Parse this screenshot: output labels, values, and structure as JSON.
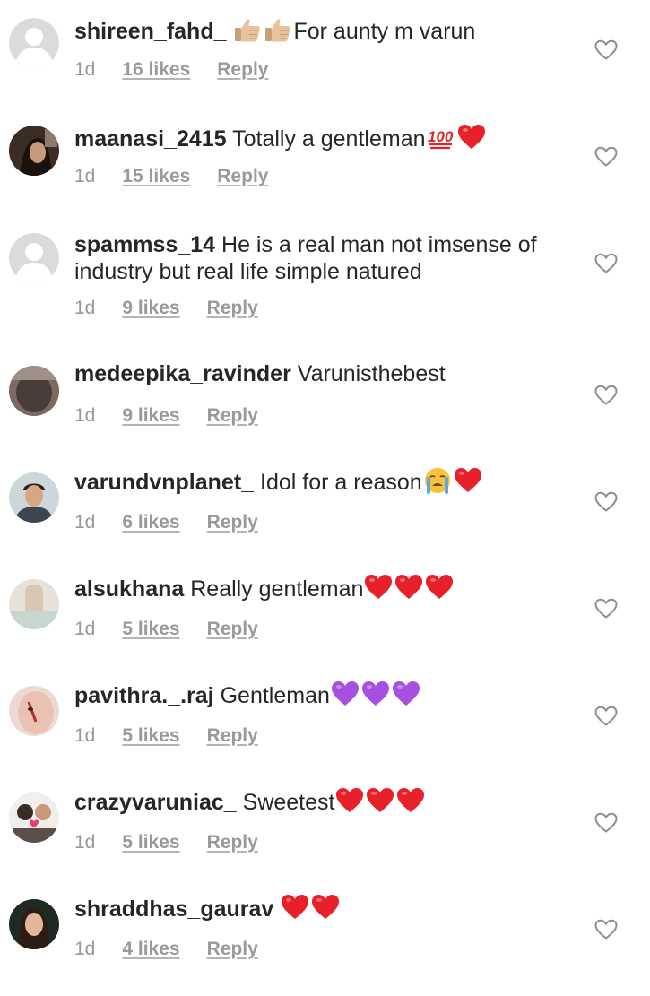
{
  "comments": [
    {
      "username": "shireen_fahd_",
      "text": "For aunty m varun",
      "emojis_before": [
        "thumbs-up",
        "thumbs-up"
      ],
      "emojis_after": [],
      "time": "1d",
      "likes": "16 likes",
      "reply": "Reply",
      "avatar": "default"
    },
    {
      "username": "maanasi_2415",
      "text": "Totally a gentleman",
      "emojis_before": [],
      "emojis_after": [
        "hundred",
        "red-heart"
      ],
      "time": "1d",
      "likes": "15 likes",
      "reply": "Reply",
      "avatar": "photo-dark"
    },
    {
      "username": "spammss_14",
      "text": "He is a real man not imsense of industry but real life simple natured",
      "emojis_before": [],
      "emojis_after": [],
      "time": "1d",
      "likes": "9 likes",
      "reply": "Reply",
      "avatar": "default"
    },
    {
      "username": "medeepika_ravinder",
      "text": "Varunisthebest",
      "emojis_before": [],
      "emojis_after": [],
      "time": "1d",
      "likes": "9 likes",
      "reply": "Reply",
      "avatar": "photo-blur"
    },
    {
      "username": "varundvnplanet_",
      "text": "Idol for a reason",
      "emojis_before": [],
      "emojis_after": [
        "crying-face",
        "red-heart"
      ],
      "time": "1d",
      "likes": "6 likes",
      "reply": "Reply",
      "avatar": "photo-man"
    },
    {
      "username": "alsukhana",
      "text": "Really gentleman",
      "emojis_before": [],
      "emojis_after": [
        "red-heart",
        "red-heart",
        "red-heart"
      ],
      "time": "1d",
      "likes": "5 likes",
      "reply": "Reply",
      "avatar": "photo-light"
    },
    {
      "username": "pavithra._.raj",
      "text": "Gentleman",
      "emojis_before": [],
      "emojis_after": [
        "purple-heart",
        "purple-heart",
        "purple-heart"
      ],
      "time": "1d",
      "likes": "5 likes",
      "reply": "Reply",
      "avatar": "photo-face"
    },
    {
      "username": "crazyvaruniac_",
      "text": "Sweetest",
      "emojis_before": [],
      "emojis_after": [
        "red-heart",
        "red-heart",
        "red-heart"
      ],
      "time": "1d",
      "likes": "5 likes",
      "reply": "Reply",
      "avatar": "photo-group"
    },
    {
      "username": "shraddhas_gaurav",
      "text": "",
      "emojis_before": [],
      "emojis_after": [
        "red-heart",
        "red-heart"
      ],
      "time": "1d",
      "likes": "4 likes",
      "reply": "Reply",
      "avatar": "photo-woman"
    }
  ],
  "icons": {
    "like": "heart-outline-icon"
  },
  "colors": {
    "text": "#262626",
    "meta": "#999999",
    "heart": "#e8202a",
    "purple_heart": "#a64fe0"
  }
}
